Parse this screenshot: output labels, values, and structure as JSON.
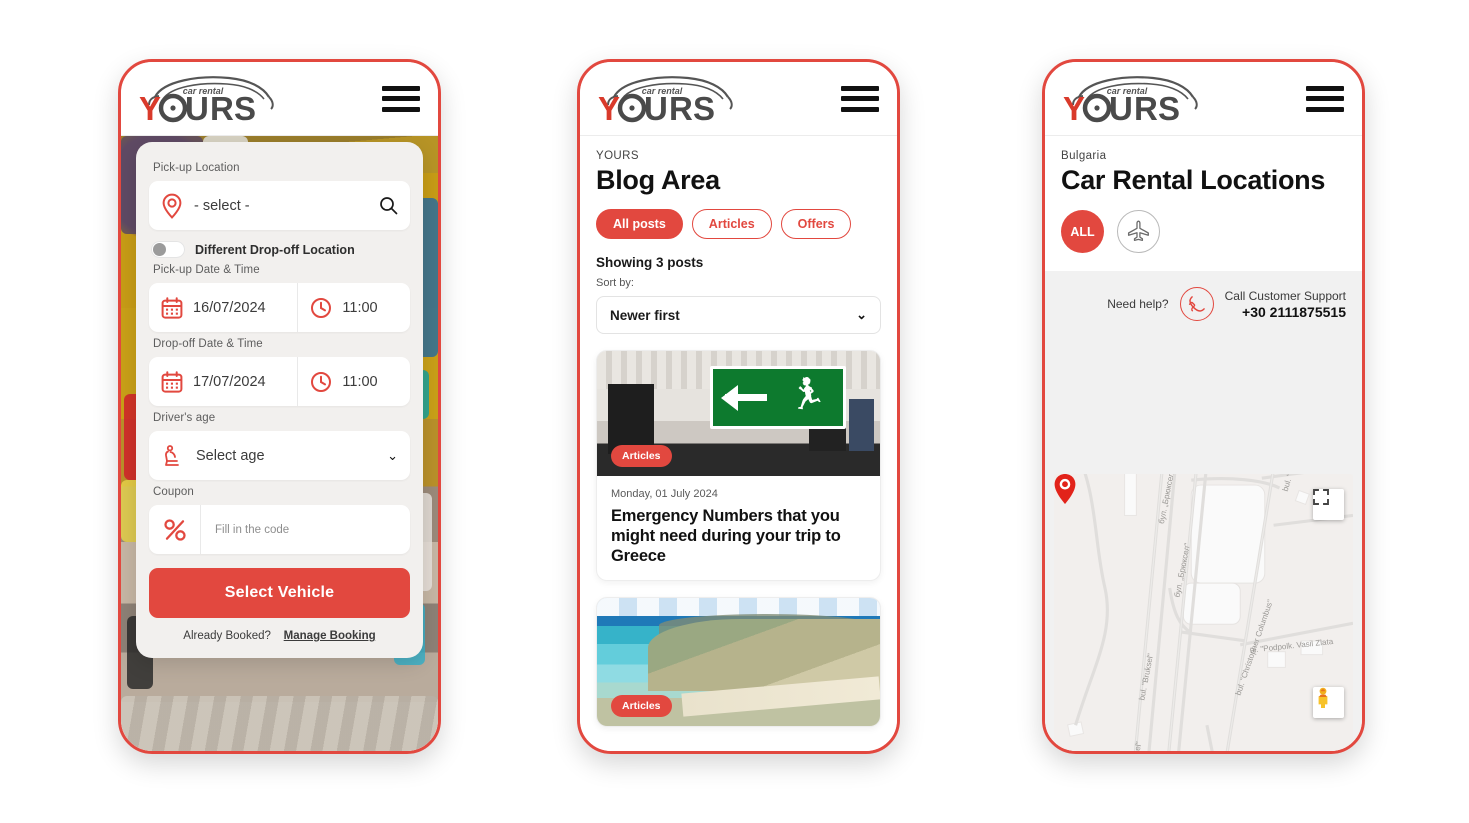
{
  "brand": {
    "name": "YOURS",
    "tagline": "car rental",
    "accent": "#e2483f",
    "dark": "#4a4a4a"
  },
  "phone1": {
    "menu_icon": "hamburger-icon",
    "booking": {
      "pickup_location_label": "Pick-up Location",
      "pickup_location_value": "- select -",
      "search_icon": "search-icon",
      "pin_icon": "map-pin-icon",
      "dropoff_toggle_label": "Different Drop-off Location",
      "pickup_datetime_label": "Pick-up Date & Time",
      "pickup_date": "16/07/2024",
      "pickup_time": "11:00",
      "dropoff_datetime_label": "Drop-off Date & Time",
      "dropoff_date": "17/07/2024",
      "dropoff_time": "11:00",
      "driver_age_label": "Driver's age",
      "driver_age_value": "Select age",
      "coupon_label": "Coupon",
      "coupon_placeholder": "Fill in the code",
      "submit_label": "Select Vehicle",
      "already_booked_text": "Already Booked?",
      "manage_booking_link": "Manage Booking",
      "calendar_icon": "calendar-icon",
      "clock_icon": "clock-icon",
      "seat_icon": "car-seat-icon",
      "percent_icon": "percent-icon",
      "chevron_icon": "chevron-down-icon"
    }
  },
  "phone2": {
    "eyebrow": "YOURS",
    "title": "Blog Area",
    "filters": [
      {
        "label": "All posts",
        "active": true
      },
      {
        "label": "Articles",
        "active": false
      },
      {
        "label": "Offers",
        "active": false
      }
    ],
    "showing": "Showing 3 posts",
    "sort_label": "Sort by:",
    "sort_value": "Newer first",
    "sort_chevron": "chevron-down-icon",
    "posts": [
      {
        "tag": "Articles",
        "date": "Monday, 01 July 2024",
        "title": "Emergency Numbers that you might need during your trip to Greece",
        "image": "emergency-exit-sign-photo"
      },
      {
        "tag": "Articles",
        "date": "",
        "title": "",
        "image": "greek-coastline-aerial-photo"
      }
    ]
  },
  "phone3": {
    "country": "Bulgaria",
    "title": "Car Rental Locations",
    "filters": [
      {
        "label": "ALL",
        "active": true,
        "icon": "all-filter"
      },
      {
        "label": "",
        "active": false,
        "icon": "airplane-icon"
      }
    ],
    "support": {
      "need_help": "Need help?",
      "phone_icon": "phone-handset-icon",
      "call_label": "Call Customer Support",
      "phone_number": "+30 2111875515"
    },
    "map": {
      "fullscreen_icon": "fullscreen-icon",
      "pegman_icon": "street-view-pegman-icon",
      "marker_icon": "location-marker-icon",
      "streets": [
        "бул. „Брюксел\"",
        "бул. „Брюксел\"",
        "bul. \"Bruksel\"",
        "bul. \"Bruksel\"",
        "bul. \"Christop",
        "bul. \"Christopher Columbus\"",
        "ul. \"Podpolk. Vasil Zlata"
      ]
    }
  }
}
